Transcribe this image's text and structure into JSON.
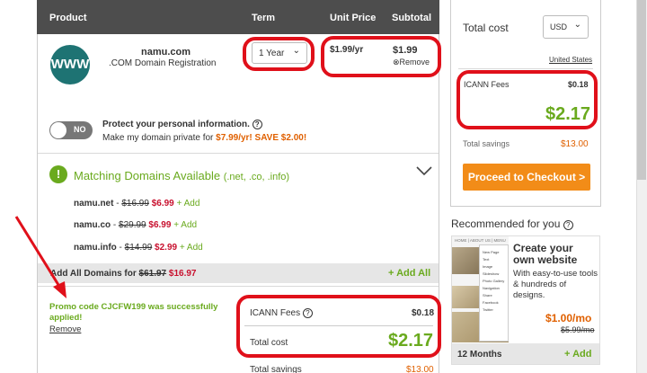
{
  "table_header": {
    "product": "Product",
    "term": "Term",
    "unit_price": "Unit Price",
    "subtotal": "Subtotal"
  },
  "domain_item": {
    "icon_text": "WWW",
    "name": "namu.com",
    "description": ".COM Domain Registration",
    "term_value": "1 Year",
    "unit_price": "$1.99/yr",
    "subtotal": "$1.99",
    "remove_label": "Remove"
  },
  "privacy": {
    "toggle_label": "NO",
    "title": "Protect your personal information.",
    "text_prefix": "Make my domain private for ",
    "offer": "$7.99/yr! SAVE $2.00!"
  },
  "matching": {
    "title": "Matching Domains Available",
    "suffix": "(.net, .co, .info)",
    "items": [
      {
        "name": "namu.net",
        "old": "$16.99",
        "new": "$6.99",
        "add": "+ Add"
      },
      {
        "name": "namu.co",
        "old": "$29.99",
        "new": "$6.99",
        "add": "+ Add"
      },
      {
        "name": "namu.info",
        "old": "$14.99",
        "new": "$2.99",
        "add": "+ Add"
      }
    ],
    "add_all_label": "Add All Domains for",
    "add_all_old": "$61.97",
    "add_all_new": "$16.97",
    "add_all_button": "+ Add All"
  },
  "promo": {
    "message": "Promo code CJCFW199 was successfully applied!",
    "remove": "Remove"
  },
  "bottom_summary": {
    "icann_label": "ICANN Fees",
    "icann_value": "$0.18",
    "total_label": "Total cost",
    "total_value": "$2.17",
    "savings_label": "Total savings",
    "savings_value": "$13.00"
  },
  "sidebar": {
    "total_cost_label": "Total cost",
    "currency": "USD",
    "country_link": "United States",
    "icann_label": "ICANN Fees",
    "icann_value": "$0.18",
    "total_value": "$2.17",
    "savings_label": "Total savings",
    "savings_value": "$13.00",
    "checkout_button": "Proceed to Checkout >"
  },
  "recommended": {
    "title": "Recommended for you",
    "ad_title": "Create your own website",
    "ad_text": "With easy-to-use tools & hundreds of designs.",
    "price": "$1.00/mo",
    "old_price": "$5.99/mo",
    "term": "12 Months",
    "add": "+ Add",
    "nav_home": "HOME",
    "nav_about": "ABOUT US",
    "nav_menu": "MENU",
    "menu_items": [
      "New Page",
      "Text",
      "Image",
      "Slideshow",
      "Photo Gallery",
      "Navigation",
      "Share",
      "Facebook",
      "Twitter"
    ]
  },
  "colors": {
    "accent_green": "#6aaa1e",
    "price_red": "#c8102e",
    "annotation_red": "#e0101a",
    "checkout_orange": "#f28c18",
    "header_gray": "#4d4d4d",
    "globe_teal": "#1e7373"
  }
}
